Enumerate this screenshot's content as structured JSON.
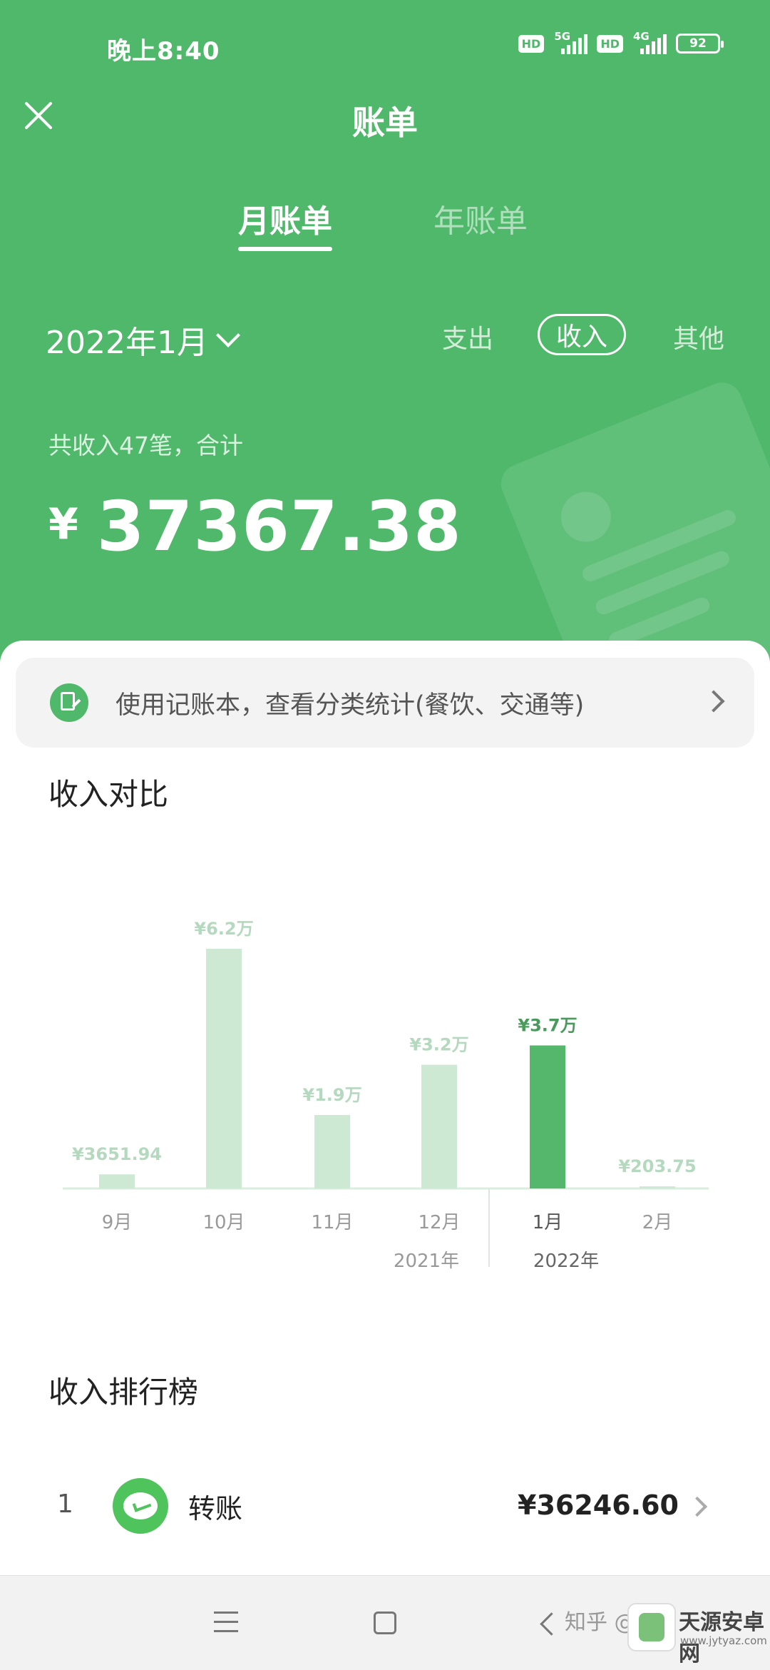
{
  "status_bar": {
    "time": "晚上8:40",
    "hd1": "HD",
    "net1": "5G",
    "hd2": "HD",
    "net2": "4G",
    "battery": "92"
  },
  "header": {
    "title": "账单"
  },
  "tabs": {
    "monthly": "月账单",
    "yearly": "年账单"
  },
  "date_selector": {
    "label": "2022年1月"
  },
  "filters": {
    "expense": "支出",
    "income": "收入",
    "other": "其他"
  },
  "summary": {
    "text": "共收入47笔，合计",
    "currency": "¥",
    "amount": "37367.38"
  },
  "ledger_banner": {
    "text": "使用记账本，查看分类统计(餐饮、交通等)"
  },
  "comparison": {
    "title": "收入对比"
  },
  "chart_data": {
    "type": "bar",
    "categories": [
      "9月",
      "10月",
      "11月",
      "12月",
      "1月",
      "2月"
    ],
    "values": [
      3651.94,
      62000,
      19000,
      32000,
      37000,
      203.75
    ],
    "value_labels": [
      "¥3651.94",
      "¥6.2万",
      "¥1.9万",
      "¥3.2万",
      "¥3.7万",
      "¥203.75"
    ],
    "year_labels": [
      "2021年",
      "2022年"
    ],
    "highlight_index": 4,
    "colors": {
      "normal": "#cde9d3",
      "highlight": "#55b76c",
      "label": "#b5d9bf",
      "highlight_label": "#4a9a5e"
    }
  },
  "ranking": {
    "title": "收入排行榜",
    "items": [
      {
        "rank": "1",
        "name": "转账",
        "amount": "¥36246.60"
      }
    ]
  },
  "watermark": {
    "zhihu": "知乎 @",
    "site_name": "天源安卓网",
    "site_url": "www.jytyaz.com"
  },
  "colors": {
    "brand_green": "#4fb86a"
  }
}
